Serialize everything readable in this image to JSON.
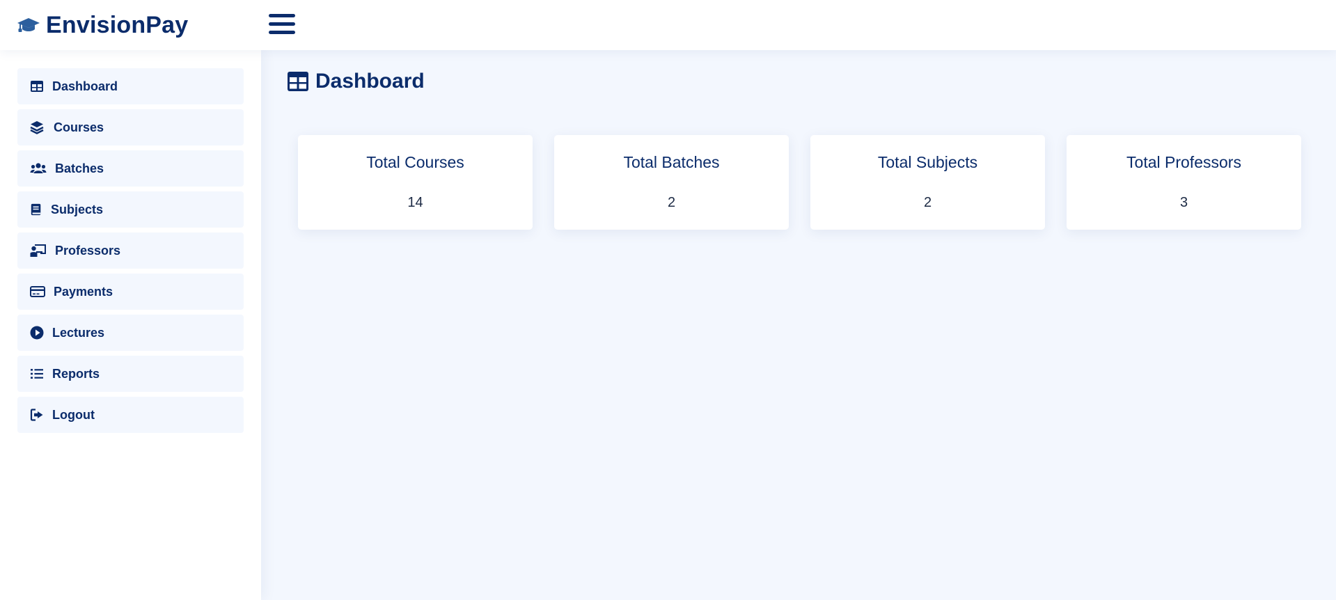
{
  "brand": {
    "name": "EnvisionPay",
    "icon": "graduation-cap-icon"
  },
  "header": {
    "menu_icon": "hamburger-menu-icon"
  },
  "sidebar": {
    "items": [
      {
        "label": "Dashboard",
        "icon": "table-icon"
      },
      {
        "label": "Courses",
        "icon": "layers-icon"
      },
      {
        "label": "Batches",
        "icon": "users-icon"
      },
      {
        "label": "Subjects",
        "icon": "book-icon"
      },
      {
        "label": "Professors",
        "icon": "chalkboard-teacher-icon"
      },
      {
        "label": "Payments",
        "icon": "credit-card-icon"
      },
      {
        "label": "Lectures",
        "icon": "play-circle-icon"
      },
      {
        "label": "Reports",
        "icon": "list-icon"
      },
      {
        "label": "Logout",
        "icon": "sign-out-icon"
      }
    ]
  },
  "main": {
    "title": "Dashboard",
    "stats": [
      {
        "title": "Total Courses",
        "value": "14"
      },
      {
        "title": "Total Batches",
        "value": "2"
      },
      {
        "title": "Total Subjects",
        "value": "2"
      },
      {
        "title": "Total Professors",
        "value": "3"
      }
    ]
  },
  "colors": {
    "primary": "#0b2c6b",
    "background": "#f3f7fe",
    "surface": "#ffffff",
    "brand_icon": "#2c5f9e"
  }
}
